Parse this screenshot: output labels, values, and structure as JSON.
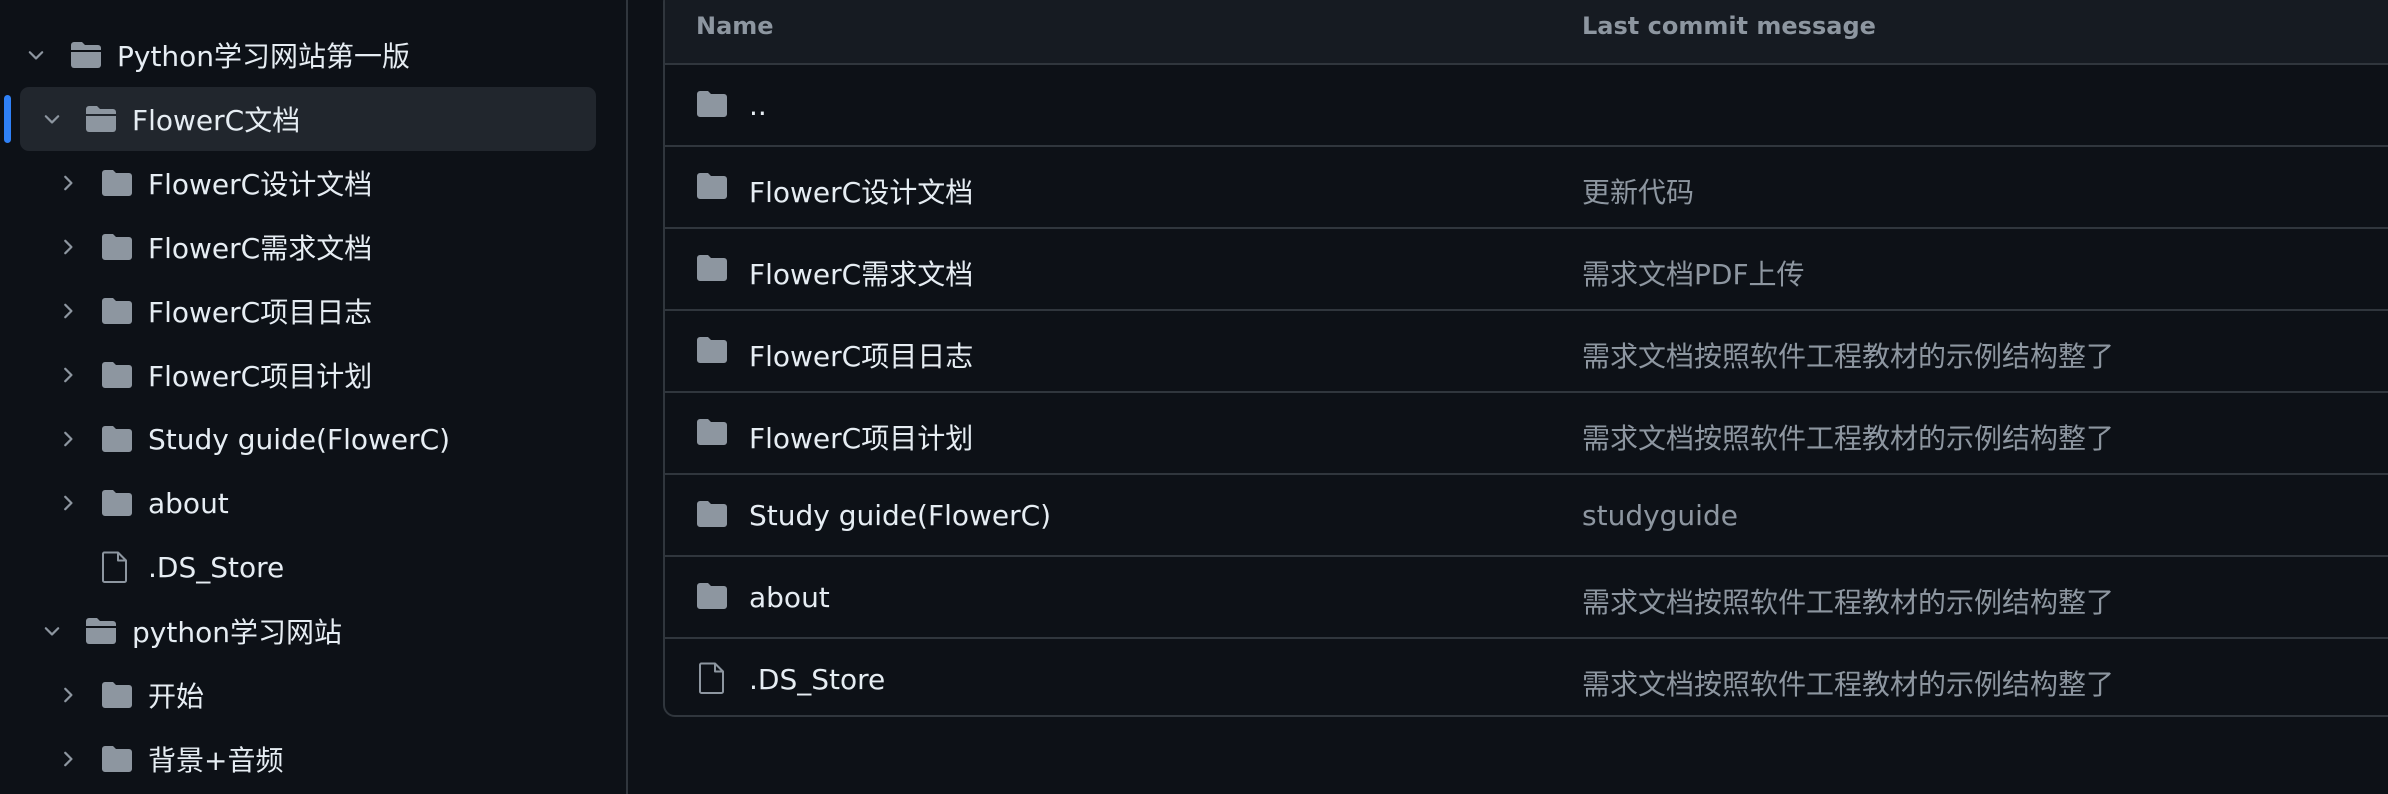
{
  "sidebar": {
    "tree": [
      {
        "label": "Python学习网站第一版",
        "type": "folder",
        "expanded": true,
        "selected": false
      },
      {
        "label": "FlowerC文档",
        "type": "folder",
        "expanded": true,
        "selected": true
      },
      {
        "label": "FlowerC设计文档",
        "type": "folder",
        "expanded": false,
        "selected": false
      },
      {
        "label": "FlowerC需求文档",
        "type": "folder",
        "expanded": false,
        "selected": false
      },
      {
        "label": "FlowerC项目日志",
        "type": "folder",
        "expanded": false,
        "selected": false
      },
      {
        "label": "FlowerC项目计划",
        "type": "folder",
        "expanded": false,
        "selected": false
      },
      {
        "label": "Study guide(FlowerC)",
        "type": "folder",
        "expanded": false,
        "selected": false
      },
      {
        "label": "about",
        "type": "folder",
        "expanded": false,
        "selected": false
      },
      {
        "label": ".DS_Store",
        "type": "file",
        "expanded": false,
        "selected": false
      },
      {
        "label": "python学习网站",
        "type": "folder",
        "expanded": true,
        "selected": false
      },
      {
        "label": "开始",
        "type": "folder",
        "expanded": false,
        "selected": false
      },
      {
        "label": "背景+音频",
        "type": "folder",
        "expanded": false,
        "selected": false
      }
    ]
  },
  "table": {
    "headers": {
      "name": "Name",
      "message": "Last commit message"
    },
    "rows": [
      {
        "name": "..",
        "type": "folder",
        "message": ""
      },
      {
        "name": "FlowerC设计文档",
        "type": "folder",
        "message": "更新代码"
      },
      {
        "name": "FlowerC需求文档",
        "type": "folder",
        "message": "需求文档PDF上传"
      },
      {
        "name": "FlowerC项目日志",
        "type": "folder",
        "message": "需求文档按照软件工程教材的示例结构整了"
      },
      {
        "name": "FlowerC项目计划",
        "type": "folder",
        "message": "需求文档按照软件工程教材的示例结构整了"
      },
      {
        "name": "Study guide(FlowerC)",
        "type": "folder",
        "message": "studyguide"
      },
      {
        "name": "about",
        "type": "folder",
        "message": "需求文档按照软件工程教材的示例结构整了"
      },
      {
        "name": ".DS_Store",
        "type": "file",
        "message": "需求文档按照软件工程教材的示例结构整了"
      }
    ]
  },
  "colors": {
    "background": "#0d1117",
    "header_bg": "#161b22",
    "selected_bg": "#21262d",
    "border": "#30363d",
    "accent": "#2f81f7",
    "icon": "#8d96a0",
    "text": "#e6edf3",
    "muted": "#8d96a0"
  }
}
